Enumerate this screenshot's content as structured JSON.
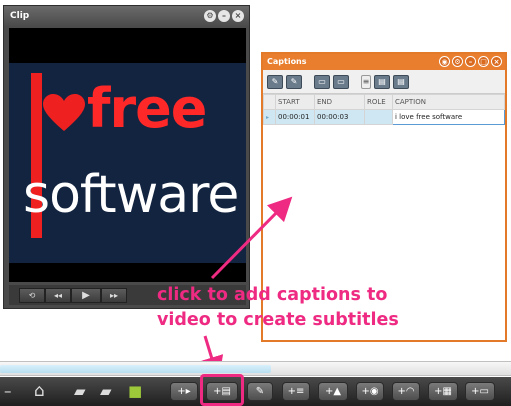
{
  "clip_window": {
    "title": "Clip",
    "window_buttons": [
      "settings-icon",
      "minimize-icon",
      "close-icon"
    ],
    "video_logo": {
      "letter": "I",
      "word1": "free",
      "word2": "software"
    },
    "controls": [
      "rewind-icon",
      "prev-icon",
      "play-icon",
      "next-icon"
    ]
  },
  "captions_window": {
    "title": "Captions",
    "columns": [
      "START",
      "END",
      "ROLE",
      "CAPTION"
    ],
    "rows": [
      {
        "start": "00:00:01",
        "end": "00:00:03",
        "role": "",
        "caption": "i love free software"
      }
    ],
    "toolbar_icons": [
      "add-caption-icon",
      "remove-caption-icon",
      "caption-left-icon",
      "caption-right-icon",
      "document-icon",
      "import-icon",
      "export-icon"
    ]
  },
  "annotation": {
    "line1": "click to add captions to",
    "line2": "video to create subtitles",
    "color": "#ee2a82"
  },
  "timeline": {
    "progress_fraction": 0.53
  },
  "bottom_toolbar": {
    "icons": [
      "home-icon",
      "folder-open-icon",
      "folder-icon",
      "save-icon",
      "add-video-icon",
      "add-caption-icon",
      "edit-icon",
      "add-list-icon",
      "add-image-icon",
      "add-location-icon",
      "add-rss-icon",
      "add-grid-icon",
      "add-frame-icon"
    ]
  },
  "colors": {
    "accent_orange": "#e87e2e",
    "highlight_pink": "#ee2a82"
  }
}
